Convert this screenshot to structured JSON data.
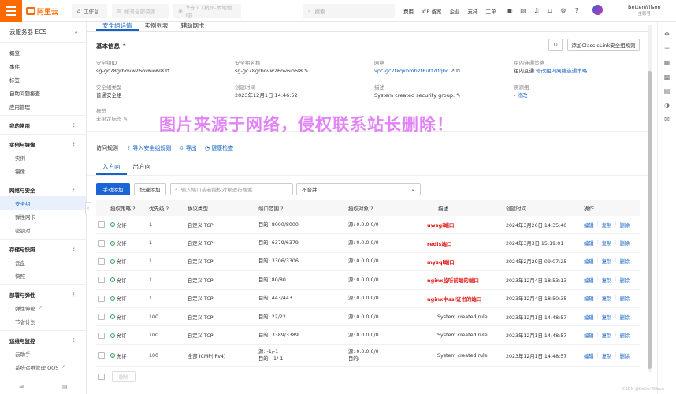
{
  "topbar": {
    "brand": "阿里云",
    "workbench": "工作台",
    "account_placeholder": "帐号全部资源",
    "region": "华东1（杭州-本地地域）",
    "search_placeholder": "搜索...",
    "nav": [
      "费用",
      "ICP 备案",
      "企业",
      "支持",
      "工单"
    ],
    "user_name": "BetterWilson",
    "user_sub": "主账号"
  },
  "sidebar": {
    "title": "云服务器 ECS",
    "items": [
      {
        "label": "概览",
        "type": "item"
      },
      {
        "label": "事件",
        "type": "item"
      },
      {
        "label": "标签",
        "type": "item"
      },
      {
        "label": "自助问题排查",
        "type": "item"
      },
      {
        "label": "应用管理",
        "type": "item"
      },
      {
        "label": "我的常用",
        "type": "sec"
      },
      {
        "label": "实例与镜像",
        "type": "sec"
      },
      {
        "label": "实例",
        "type": "sub"
      },
      {
        "label": "镜像",
        "type": "sub"
      },
      {
        "label": "网络与安全",
        "type": "sec"
      },
      {
        "label": "安全组",
        "type": "sub-active"
      },
      {
        "label": "弹性网卡",
        "type": "sub"
      },
      {
        "label": "密钥对",
        "type": "sub"
      },
      {
        "label": "存储与快照",
        "type": "sec"
      },
      {
        "label": "云盘",
        "type": "sub"
      },
      {
        "label": "快照",
        "type": "sub"
      },
      {
        "label": "部署与弹性",
        "type": "sec"
      },
      {
        "label": "弹性伸缩",
        "type": "sub"
      },
      {
        "label": "节省计划",
        "type": "sub"
      },
      {
        "label": "运维与监控",
        "type": "sec"
      },
      {
        "label": "云助手",
        "type": "sub"
      },
      {
        "label": "系统运维管理 OOS",
        "type": "sub"
      }
    ]
  },
  "tabs": [
    "安全组详情",
    "实例列表",
    "辅助网卡"
  ],
  "basic_info": {
    "heading": "基本信息",
    "add_classiclink": "添加ClassicLink安全组规则",
    "fields": {
      "sg_id_label": "安全组ID",
      "sg_id": "sg-gc78grbovw26ov6io6l8",
      "sg_name_label": "安全组名称",
      "sg_name": "sg-gc78grbovw26ov6io6l8",
      "network_label": "网络",
      "network": "vpc-gc7tkqxbmb2t6utf70qbc",
      "intra_label": "组内连通策略",
      "intra": "组内互通",
      "intra_link": "修改组内网络连通策略",
      "type_label": "安全组类型",
      "type": "普通安全组",
      "created_label": "创建时间",
      "created": "2023年12月1日 14:46:52",
      "desc_label": "描述",
      "desc": "System created security group.",
      "rg_label": "资源组",
      "rg": "-",
      "rg_link": "修改",
      "tag_label": "标签",
      "tag": "未绑定标签"
    }
  },
  "watermark": "图片来源于网络，侵权联系站长删除！",
  "rules": {
    "heading": "访问规则",
    "import": "导入安全组规则",
    "export": "导出",
    "check": "健康检查",
    "dir_tabs": [
      "入方向",
      "出方向"
    ],
    "btn_manual": "手动添加",
    "btn_quick": "快速添加",
    "search_placeholder": "输入端口或者授权对象进行搜索",
    "select": "不合并",
    "columns": [
      "授权策略",
      "优先级",
      "协议类型",
      "端口范围",
      "授权对象",
      "描述",
      "创建时间",
      "操作"
    ],
    "rows": [
      {
        "policy": "允许",
        "prio": "1",
        "proto": "自定义 TCP",
        "port": "目的: 8000/8000",
        "obj": "源: 0.0.0.0/0",
        "desc": "uwsgi端口",
        "red": true,
        "time": "2024年3月26日 14:35:40"
      },
      {
        "policy": "允许",
        "prio": "1",
        "proto": "自定义 TCP",
        "port": "目的: 6379/6379",
        "obj": "源: 0.0.0.0/0",
        "desc": "redis端口",
        "red": true,
        "time": "2024年3月3日 15:19:01"
      },
      {
        "policy": "允许",
        "prio": "1",
        "proto": "自定义 TCP",
        "port": "目的: 3306/3306",
        "obj": "源: 0.0.0.0/0",
        "desc": "mysql端口",
        "red": true,
        "time": "2024年2月29日 09:07:25"
      },
      {
        "policy": "允许",
        "prio": "1",
        "proto": "自定义 TCP",
        "port": "目的: 80/80",
        "obj": "源: 0.0.0.0/0",
        "desc": "nginx监听前端的端口",
        "red": true,
        "time": "2023年12月4日 18:53:13"
      },
      {
        "policy": "允许",
        "prio": "1",
        "proto": "自定义 TCP",
        "port": "目的: 443/443",
        "obj": "源: 0.0.0.0/0",
        "desc": "nginx中ssl证书的端口",
        "red": true,
        "time": "2023年12月4日 18:50:35"
      },
      {
        "policy": "允许",
        "prio": "100",
        "proto": "自定义 TCP",
        "port": "目的: 22/22",
        "obj": "源: 0.0.0.0/0",
        "desc": "System created rule.",
        "red": false,
        "time": "2023年12月1日 14:48:57"
      },
      {
        "policy": "允许",
        "prio": "100",
        "proto": "自定义 TCP",
        "port": "目的: 3389/3389",
        "obj": "源: 0.0.0.0/0",
        "desc": "System created rule.",
        "red": false,
        "time": "2023年12月1日 14:48:57"
      },
      {
        "policy": "允许",
        "prio": "100",
        "proto": "全部 ICMP(IPv4)",
        "port": "源: -1/-1",
        "port2": "目的: -1/-1",
        "obj": "源: 0.0.0.0/0",
        "obj2": "目的:",
        "desc": "System created rule.",
        "red": false,
        "time": "2023年12月1日 14:48:57"
      }
    ],
    "ops": [
      "编辑",
      "复制",
      "删除"
    ],
    "delete_btn": "删除"
  },
  "footer_credit": "CSDN @BetterWilson"
}
